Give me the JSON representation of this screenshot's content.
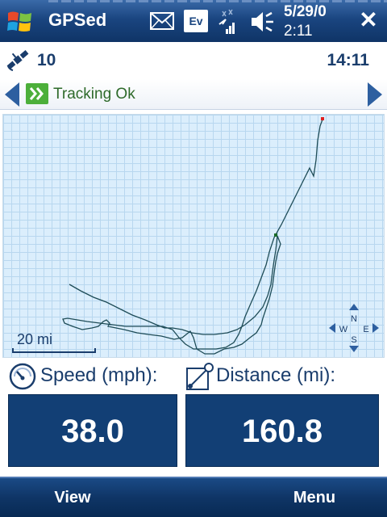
{
  "title_bar": {
    "app_title": "GPSed",
    "ev_badge": "Ev",
    "date": "5/29/0",
    "time": "2:11"
  },
  "info_row": {
    "satellite_count": "10",
    "clock": "14:11"
  },
  "status": {
    "text": "Tracking Ok"
  },
  "map": {
    "scale_label": "20 mi",
    "compass": {
      "n": "N",
      "s": "S",
      "e": "E",
      "w": "W"
    },
    "track_color": "#1e4c57",
    "start_marker_color": "#e02020",
    "current_marker_color": "#1c6b2a"
  },
  "speed": {
    "label": "Speed (mph):",
    "value": "38.0"
  },
  "distance": {
    "label": "Distance (mi):",
    "value": "160.8"
  },
  "softkeys": {
    "left": "View",
    "right": "Menu"
  },
  "colors": {
    "accent": "#123f75",
    "text": "#1a3d6c",
    "map_bg": "#dbeefc"
  }
}
